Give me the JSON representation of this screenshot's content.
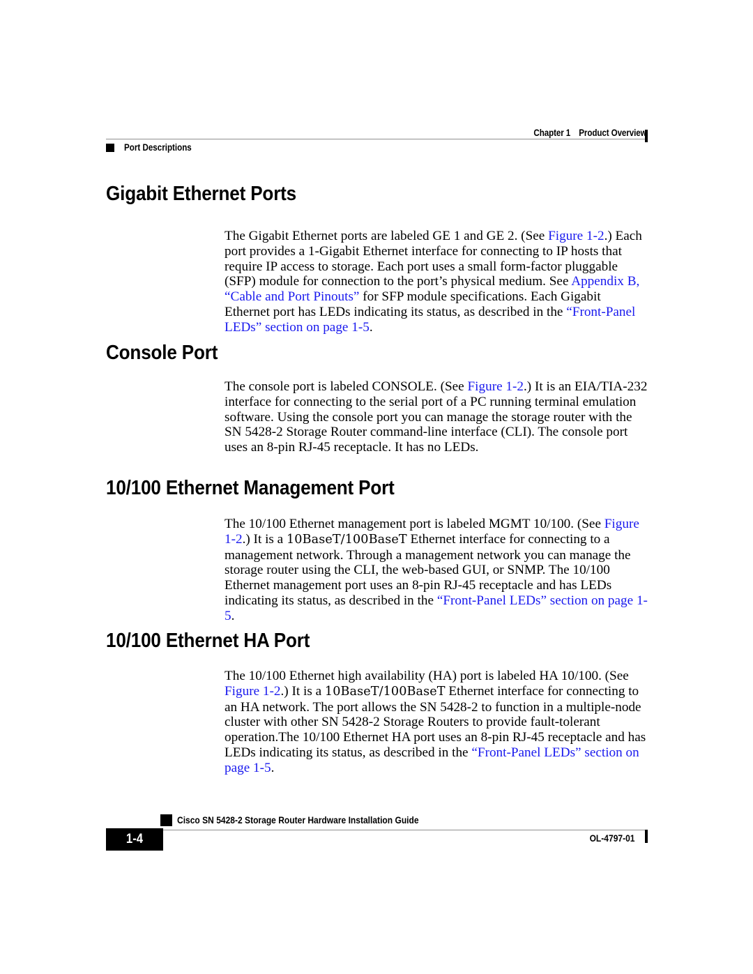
{
  "document": {
    "page_background": "#ffffff",
    "link_color": "#1a1aee"
  },
  "header": {
    "chapter_label": "Chapter 1",
    "chapter_title": "Product Overview",
    "section_name": "Port Descriptions"
  },
  "sections": [
    {
      "heading": "Gigabit Ethernet Ports",
      "paragraph_runs": [
        {
          "text": "The Gigabit Ethernet ports are labeled GE 1 and GE 2. (See ",
          "style": "plain"
        },
        {
          "text": "Figure 1-2",
          "style": "link"
        },
        {
          "text": ".) Each port provides a 1-Gigabit Ethernet interface for connecting to IP hosts that require IP access to storage. Each port uses a small form-factor pluggable (SFP) module for connection to the port’s physical medium. See ",
          "style": "plain"
        },
        {
          "text": "Appendix B, “Cable and Port Pinouts”",
          "style": "link"
        },
        {
          "text": " for SFP module specifications. Each Gigabit Ethernet port has LEDs indicating its status, as described in the ",
          "style": "plain"
        },
        {
          "text": "“Front-Panel LEDs” section on page 1-5",
          "style": "link"
        },
        {
          "text": ".",
          "style": "plain"
        }
      ]
    },
    {
      "heading": "Console Port",
      "paragraph_runs": [
        {
          "text": "The console port is labeled CONSOLE. (See ",
          "style": "plain"
        },
        {
          "text": "Figure 1-2",
          "style": "link"
        },
        {
          "text": ".) It is an EIA/TIA-232 interface for connecting to the serial port of a PC running terminal emulation software. Using the console port you can manage the storage router with the SN 5428-2 Storage Router command-line interface (CLI). The console port uses an 8-pin RJ-45 receptacle. It has no LEDs.",
          "style": "plain"
        }
      ]
    },
    {
      "heading": "10/100 Ethernet Management Port",
      "paragraph_runs": [
        {
          "text": "The 10/100 Ethernet management port is labeled MGMT 10/100. (See ",
          "style": "plain"
        },
        {
          "text": "Figure 1-2",
          "style": "link"
        },
        {
          "text": ".) It is a ",
          "style": "plain"
        },
        {
          "text": "10BaseT/100BaseT",
          "style": "alt-serif"
        },
        {
          "text": " Ethernet interface for connecting to a management network. Through a management network you can manage the storage router using the CLI, the web-based GUI, or SNMP. The 10/100 Ethernet management port uses an 8-pin RJ-45 receptacle and has LEDs indicating its status, as described in the ",
          "style": "plain"
        },
        {
          "text": "“Front-Panel LEDs” section on page 1-5",
          "style": "link"
        },
        {
          "text": ".",
          "style": "plain"
        }
      ]
    },
    {
      "heading": "10/100 Ethernet HA Port",
      "paragraph_runs": [
        {
          "text": "The 10/100 Ethernet high availability (HA) port is labeled HA 10/100. (See ",
          "style": "plain"
        },
        {
          "text": "Figure 1-2",
          "style": "link"
        },
        {
          "text": ".) It is a ",
          "style": "plain"
        },
        {
          "text": "10BaseT/100BaseT",
          "style": "alt-serif"
        },
        {
          "text": " Ethernet interface for connecting to an HA network. The port allows the SN 5428-2 to function in a multiple-node cluster with other SN 5428-2 Storage Routers to provide fault-tolerant operation.The 10/100 Ethernet HA port uses an 8-pin RJ-45 receptacle and has LEDs indicating its status, as described in the ",
          "style": "plain"
        },
        {
          "text": "“Front-Panel LEDs” section on page 1-5",
          "style": "link"
        },
        {
          "text": ".",
          "style": "plain"
        }
      ]
    }
  ],
  "footer": {
    "guide_title": "Cisco SN 5428-2 Storage Router Hardware Installation Guide",
    "page_number": "1-4",
    "document_id": "OL-4797-01"
  },
  "layout": {
    "section_tops": [
      0,
      228,
      422,
      641
    ],
    "paragraph_tops": [
      66,
      282,
      479,
      697
    ]
  }
}
